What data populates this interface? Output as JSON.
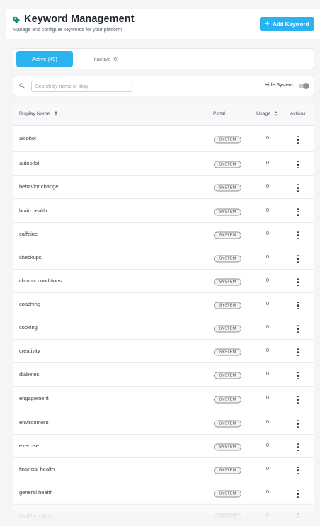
{
  "header": {
    "title": "Keyword Management",
    "subtitle": "Manage and configure keywords for your platform",
    "add_button_label": "Add Keyword",
    "tag_icon": "tag-icon",
    "accent": "#2bb3ef",
    "tag_color": "#1a8f7a"
  },
  "tabs": {
    "active_label": "Active (49)",
    "inactive_label": "Inactive (0)"
  },
  "filter": {
    "search_placeholder": "Search by name or slug",
    "search_value": "",
    "hide_system_label": "Hide System",
    "hide_system_on": false
  },
  "table": {
    "columns": {
      "display_name": "Display Name",
      "portal": "Portal",
      "usage": "Usage",
      "actions": "Actions"
    },
    "rows": [
      {
        "name": "alcohol",
        "portal": "SYSTEM",
        "usage": "0"
      },
      {
        "name": "autopilot",
        "portal": "SYSTEM",
        "usage": "0"
      },
      {
        "name": "behavior change",
        "portal": "SYSTEM",
        "usage": "0"
      },
      {
        "name": "brain health",
        "portal": "SYSTEM",
        "usage": "0"
      },
      {
        "name": "caffeine",
        "portal": "SYSTEM",
        "usage": "0"
      },
      {
        "name": "checkups",
        "portal": "SYSTEM",
        "usage": "0"
      },
      {
        "name": "chronic conditions",
        "portal": "SYSTEM",
        "usage": "0"
      },
      {
        "name": "coaching",
        "portal": "SYSTEM",
        "usage": "0"
      },
      {
        "name": "cooking",
        "portal": "SYSTEM",
        "usage": "0"
      },
      {
        "name": "creativity",
        "portal": "SYSTEM",
        "usage": "0"
      },
      {
        "name": "diabetes",
        "portal": "SYSTEM",
        "usage": "0"
      },
      {
        "name": "engagement",
        "portal": "SYSTEM",
        "usage": "0"
      },
      {
        "name": "environment",
        "portal": "SYSTEM",
        "usage": "0"
      },
      {
        "name": "exercise",
        "portal": "SYSTEM",
        "usage": "0"
      },
      {
        "name": "financial health",
        "portal": "SYSTEM",
        "usage": "0"
      },
      {
        "name": "general health",
        "portal": "SYSTEM",
        "usage": "0"
      },
      {
        "name": "healthy eating",
        "portal": "SYSTEM",
        "usage": "0"
      }
    ]
  }
}
